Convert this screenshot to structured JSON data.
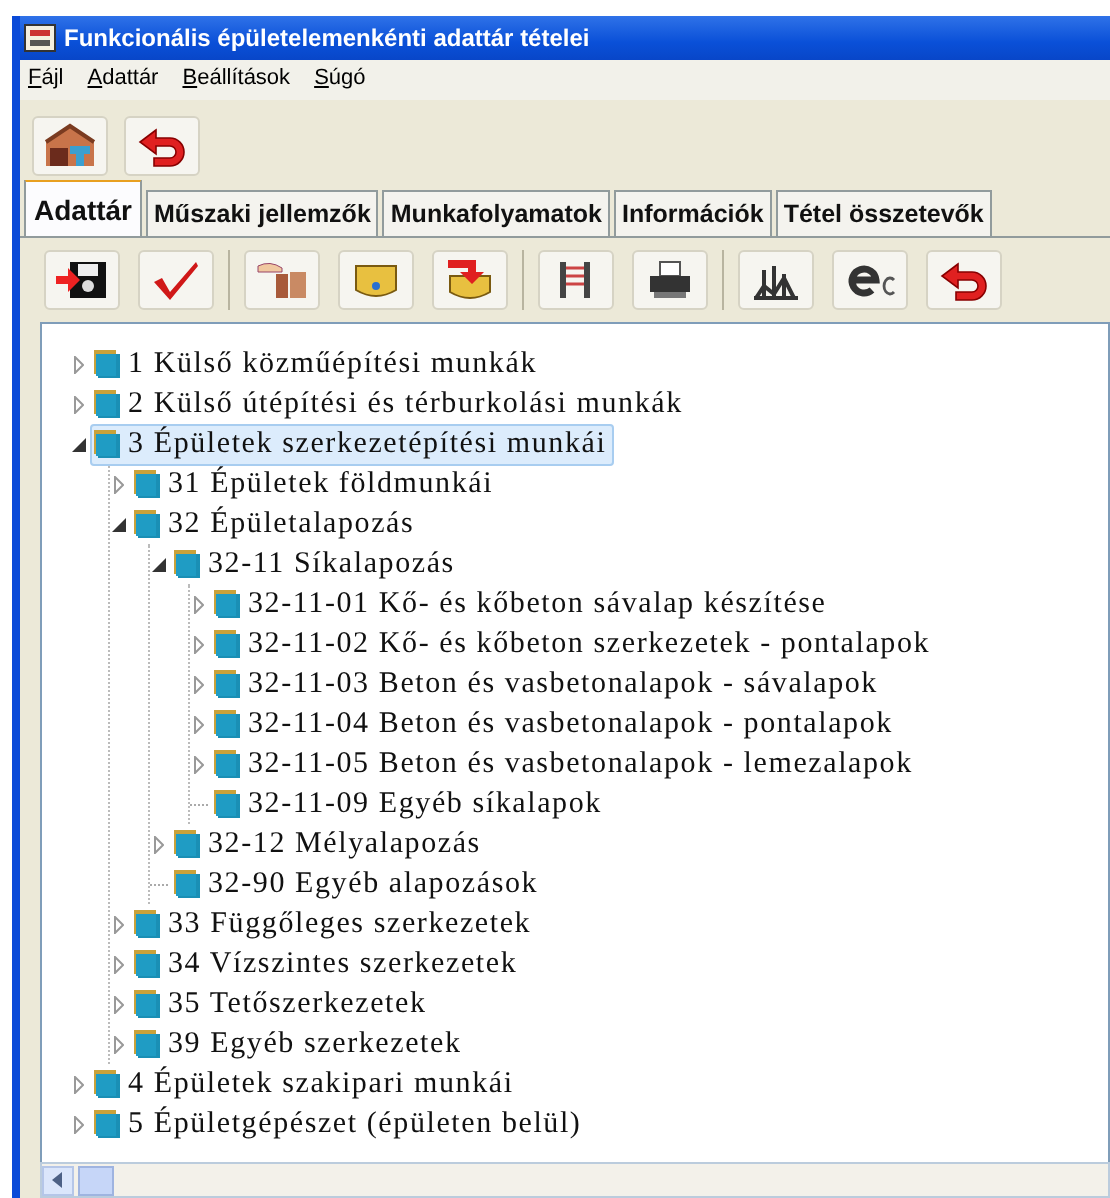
{
  "window": {
    "title": "Funkcionális épületelemenkénti adattár tételei"
  },
  "menu": [
    "Fájl",
    "Adattár",
    "Beállítások",
    "Súgó"
  ],
  "tabs": [
    {
      "label": "Adattár",
      "selected": true
    },
    {
      "label": "Műszaki jellemzők",
      "selected": false
    },
    {
      "label": "Munkafolyamatok",
      "selected": false
    },
    {
      "label": "Információk",
      "selected": false
    },
    {
      "label": "Tétel összetevők",
      "selected": false
    }
  ],
  "tree": [
    {
      "label": "1 Külső közműépítési munkák",
      "kind": "branch",
      "expanded": false,
      "selected": false
    },
    {
      "label": "2 Külső útépítési és térburkolási munkák",
      "kind": "branch",
      "expanded": false,
      "selected": false
    },
    {
      "label": "3 Épületek szerkezetépítési munkái",
      "kind": "branch",
      "expanded": true,
      "selected": true,
      "children": [
        {
          "label": "31 Épületek földmunkái",
          "kind": "branch",
          "expanded": false,
          "selected": false
        },
        {
          "label": "32 Épületalapozás",
          "kind": "branch",
          "expanded": true,
          "selected": false,
          "children": [
            {
              "label": "32-11 Síkalapozás",
              "kind": "branch",
              "expanded": true,
              "selected": false,
              "children": [
                {
                  "label": "32-11-01 Kő- és kőbeton sávalap készítése",
                  "kind": "branch",
                  "expanded": false,
                  "selected": false
                },
                {
                  "label": "32-11-02 Kő- és kőbeton szerkezetek - pontalapok",
                  "kind": "branch",
                  "expanded": false,
                  "selected": false
                },
                {
                  "label": "32-11-03 Beton és vasbetonalapok - sávalapok",
                  "kind": "branch",
                  "expanded": false,
                  "selected": false
                },
                {
                  "label": "32-11-04 Beton és vasbetonalapok - pontalapok",
                  "kind": "branch",
                  "expanded": false,
                  "selected": false
                },
                {
                  "label": "32-11-05 Beton és vasbetonalapok - lemezalapok",
                  "kind": "branch",
                  "expanded": false,
                  "selected": false
                },
                {
                  "label": "32-11-09 Egyéb síkalapok",
                  "kind": "leaf",
                  "selected": false
                }
              ]
            },
            {
              "label": "32-12 Mélyalapozás",
              "kind": "branch",
              "expanded": false,
              "selected": false
            },
            {
              "label": "32-90 Egyéb alapozások",
              "kind": "leaf",
              "selected": false
            }
          ]
        },
        {
          "label": "33 Függőleges szerkezetek",
          "kind": "branch",
          "expanded": false,
          "selected": false
        },
        {
          "label": "34 Vízszintes szerkezetek",
          "kind": "branch",
          "expanded": false,
          "selected": false
        },
        {
          "label": "35 Tetőszerkezetek",
          "kind": "branch",
          "expanded": false,
          "selected": false
        },
        {
          "label": "39 Egyéb szerkezetek",
          "kind": "branch",
          "expanded": false,
          "selected": false
        }
      ]
    },
    {
      "label": "4 Épületek szakipari munkái",
      "kind": "branch",
      "expanded": false,
      "selected": false
    },
    {
      "label": "5 Épületgépészet (épületen belül)",
      "kind": "branch",
      "expanded": false,
      "selected": false
    }
  ]
}
